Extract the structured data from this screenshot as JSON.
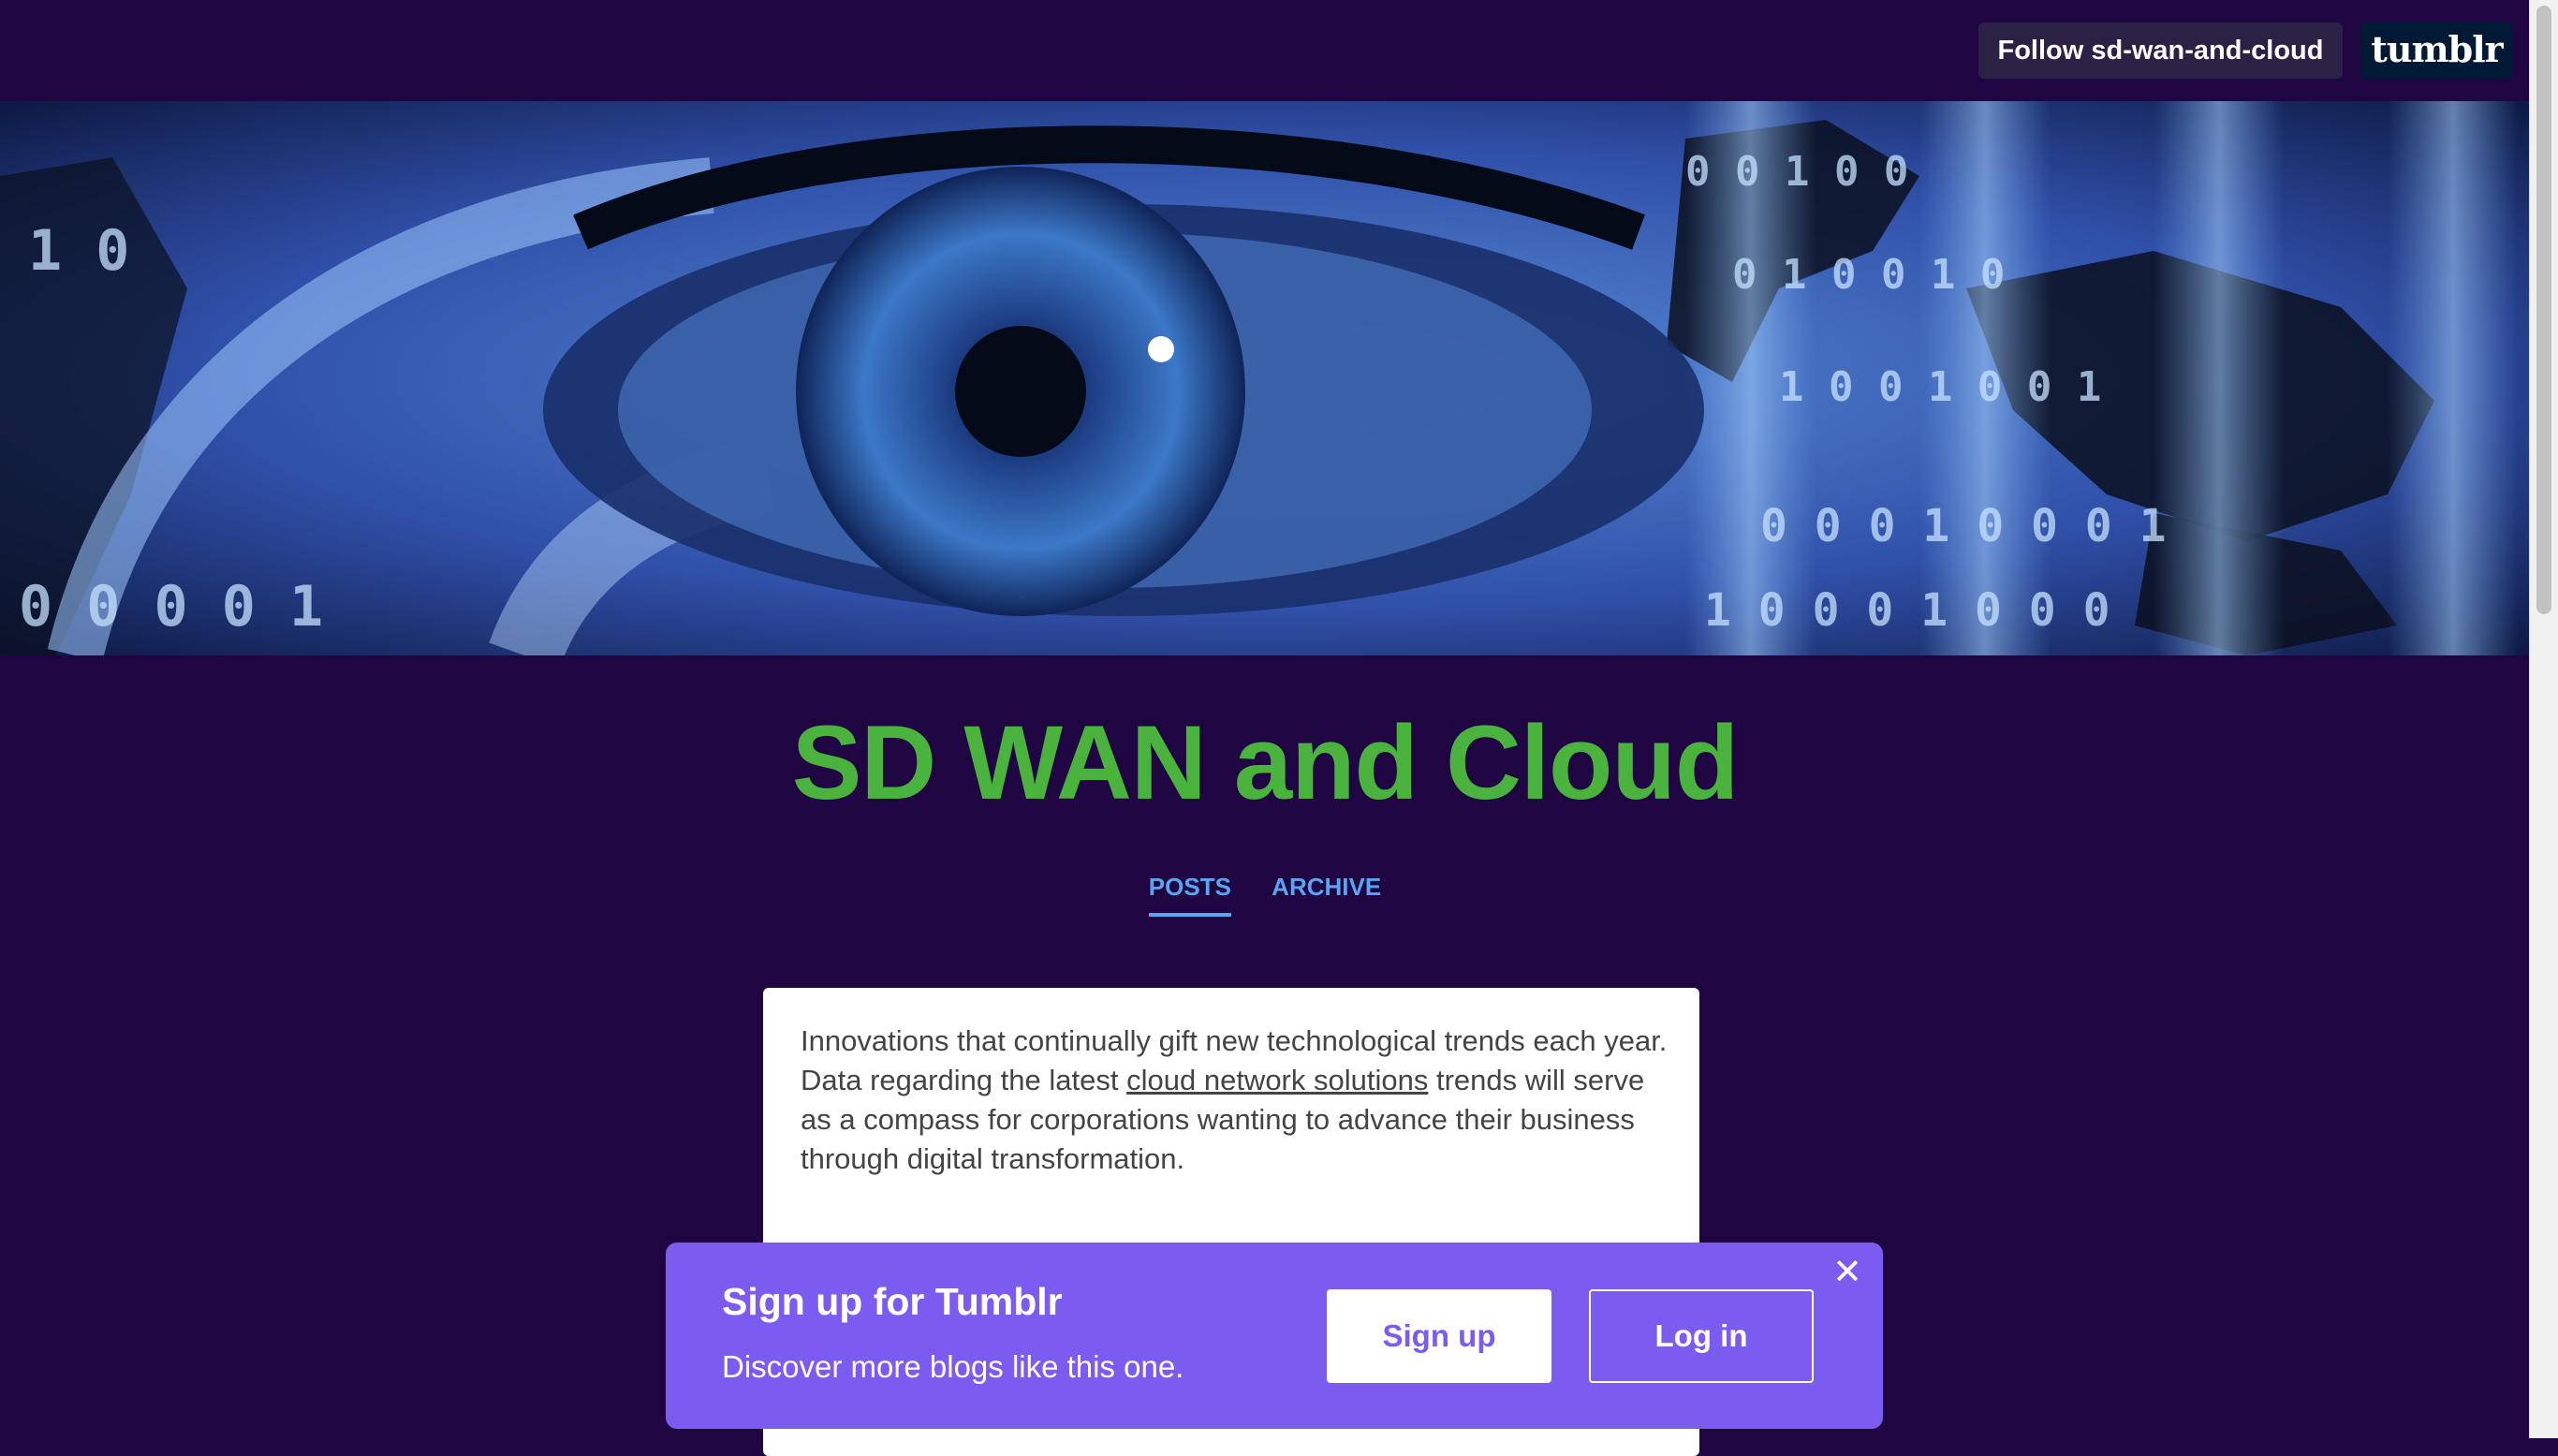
{
  "topbar": {
    "follow_label": "Follow sd-wan-and-cloud",
    "logo_text": "tumblr"
  },
  "header_image": {
    "icon": "eye-digital-world-banner"
  },
  "blog": {
    "title": "SD WAN and Cloud",
    "title_color": "#4ab33e",
    "background_color": "#1f0541"
  },
  "tabs": [
    {
      "label": "POSTS",
      "active": true
    },
    {
      "label": "ARCHIVE",
      "active": false
    }
  ],
  "post": {
    "text_before_link": "Innovations that continually gift new technological trends each year. Data regarding the latest ",
    "link_text": "cloud network solutions",
    "text_after_link": " trends will serve as a compass for corporations wanting to advance their business through digital transformation."
  },
  "signup_banner": {
    "title": "Sign up for Tumblr",
    "subtitle": "Discover more blogs like this one.",
    "signup_label": "Sign up",
    "login_label": "Log in",
    "close_icon": "close-icon",
    "background_color": "#7c5cf0"
  }
}
